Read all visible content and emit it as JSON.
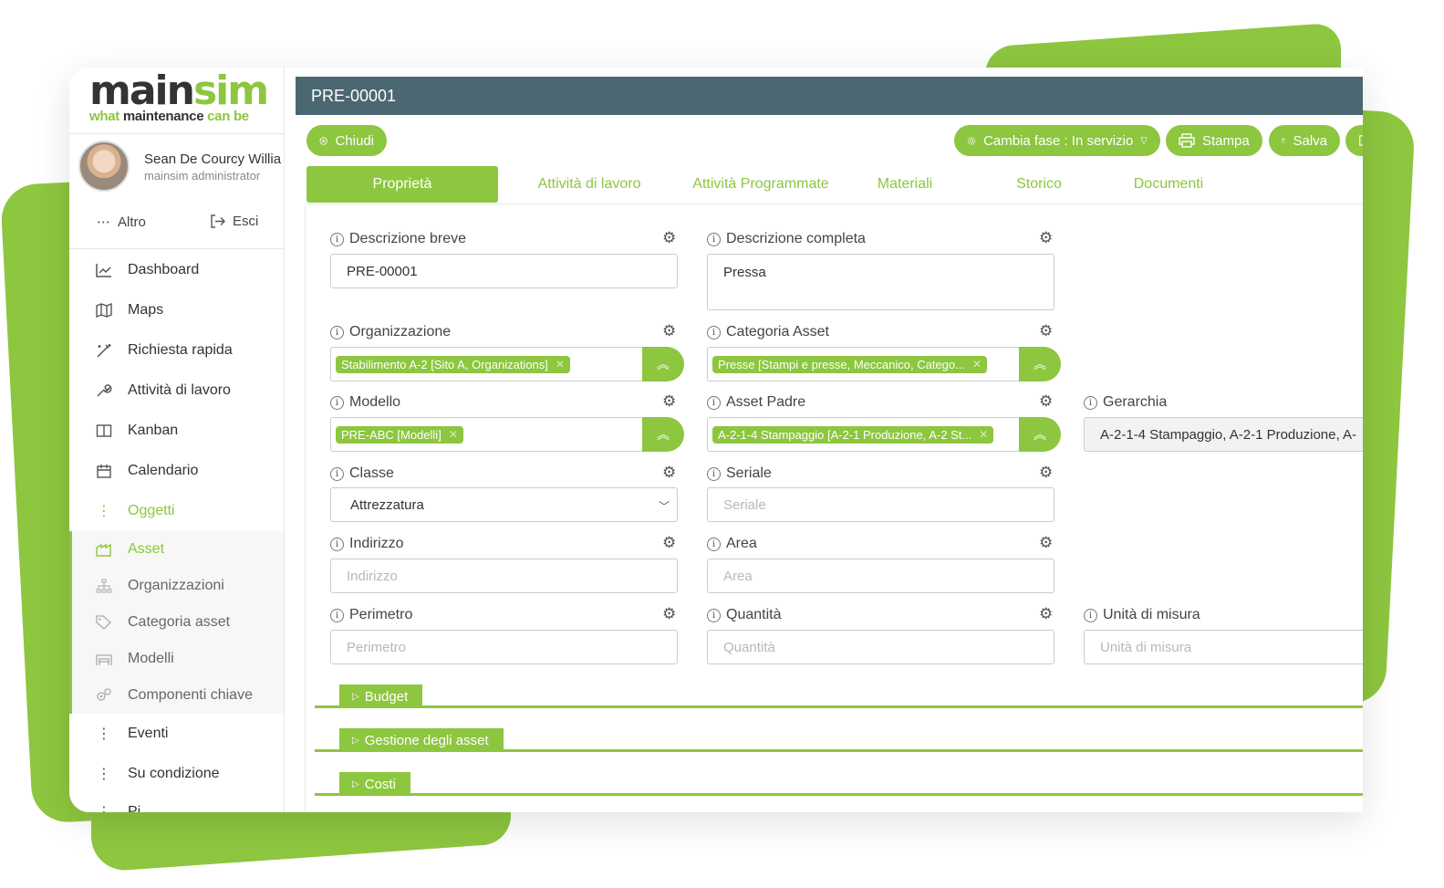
{
  "brand": {
    "name_dark": "main",
    "name_green": "sim",
    "tagline_green1": "what",
    "tagline_dark": "maintenance",
    "tagline_green2": "can be"
  },
  "user": {
    "name": "Sean De Courcy Willia",
    "role": "mainsim administrator",
    "more": "Altro",
    "logout": "Esci"
  },
  "nav": {
    "dashboard": "Dashboard",
    "maps": "Maps",
    "quick_request": "Richiesta rapida",
    "work_activities": "Attività di lavoro",
    "kanban": "Kanban",
    "calendar": "Calendario",
    "objects": "Oggetti",
    "asset": "Asset",
    "organizations": "Organizzazioni",
    "asset_category": "Categoria asset",
    "models": "Modelli",
    "key_components": "Componenti chiave",
    "events": "Eventi",
    "on_condition": "Su condizione",
    "cut_off": "Pi"
  },
  "record": {
    "title": "PRE-00001"
  },
  "toolbar": {
    "close": "Chiudi",
    "change_phase": "Cambia fase : In servizio",
    "print": "Stampa",
    "save": "Salva"
  },
  "tabs": [
    "Proprietà",
    "Attività di lavoro",
    "Attività Programmate",
    "Materiali",
    "Storico",
    "Documenti"
  ],
  "form": {
    "short_desc": {
      "label": "Descrizione breve",
      "value": "PRE-00001"
    },
    "full_desc": {
      "label": "Descrizione completa",
      "value": "Pressa"
    },
    "organization": {
      "label": "Organizzazione",
      "chip": "Stabilimento A-2 [Sito A, Organizations]"
    },
    "asset_category": {
      "label": "Categoria Asset",
      "chip": "Presse [Stampi e presse, Meccanico, Catego..."
    },
    "model": {
      "label": "Modello",
      "chip": "PRE-ABC [Modelli]"
    },
    "parent_asset": {
      "label": "Asset Padre",
      "chip": "A-2-1-4 Stampaggio [A-2-1 Produzione, A-2 St..."
    },
    "hierarchy": {
      "label": "Gerarchia",
      "value": "A-2-1-4 Stampaggio, A-2-1 Produzione, A-"
    },
    "class": {
      "label": "Classe",
      "value": "Attrezzatura"
    },
    "serial": {
      "label": "Seriale",
      "placeholder": "Seriale"
    },
    "address": {
      "label": "Indirizzo",
      "placeholder": "Indirizzo"
    },
    "area": {
      "label": "Area",
      "placeholder": "Area"
    },
    "perimeter": {
      "label": "Perimetro",
      "placeholder": "Perimetro"
    },
    "quantity": {
      "label": "Quantità",
      "placeholder": "Quantità"
    },
    "unit": {
      "label": "Unità di misura",
      "placeholder": "Unità di misura"
    }
  },
  "sections": {
    "budget": "Budget",
    "asset_mgmt": "Gestione degli asset",
    "costs": "Costi"
  },
  "colors": {
    "accent": "#8dc63f",
    "titlebar": "#4a6772"
  }
}
